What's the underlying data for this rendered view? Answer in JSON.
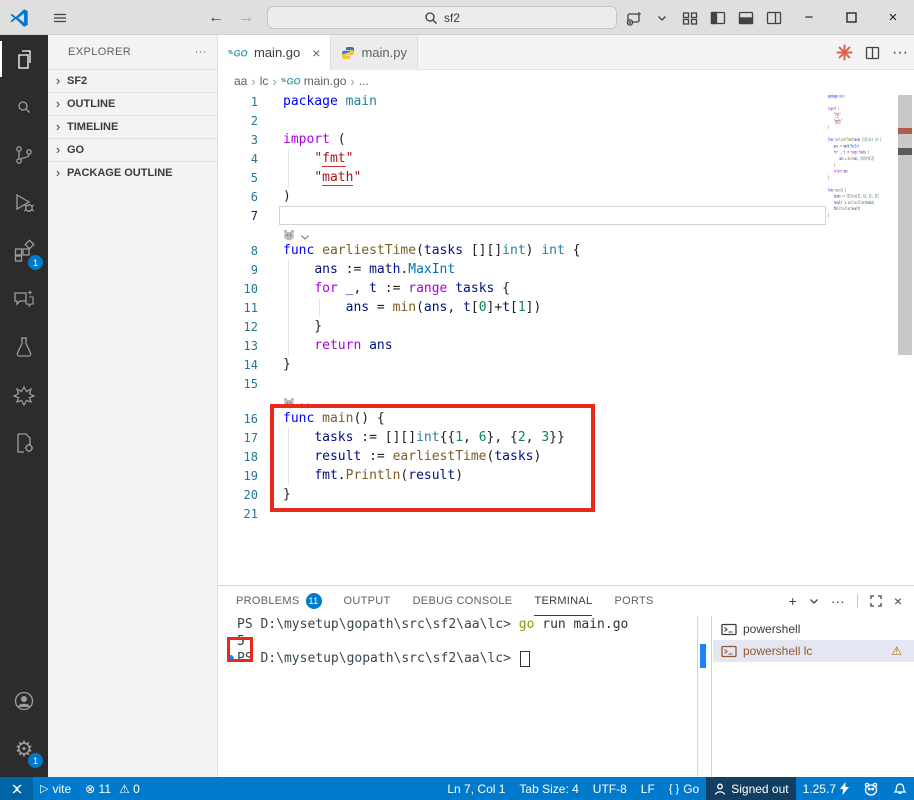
{
  "titlebar": {
    "search_value": "sf2",
    "left_icons": [
      {
        "icon": "vscode-logo-icon"
      },
      {
        "icon": "menu-icon"
      }
    ],
    "nav": [
      {
        "icon": "arrow-left-icon",
        "enabled": true
      },
      {
        "icon": "arrow-right-icon",
        "enabled": false
      }
    ],
    "right_icons": [
      {
        "icon": "profile-launch-icon"
      },
      {
        "icon": "chevron-down-icon"
      },
      {
        "icon": "layout-grid-icon"
      },
      {
        "icon": "panel-left-icon"
      },
      {
        "icon": "panel-bottom-icon"
      },
      {
        "icon": "panel-right-icon"
      }
    ],
    "window_controls": [
      {
        "icon": "minimize-icon",
        "glyph": "−"
      },
      {
        "icon": "maximize-icon"
      },
      {
        "icon": "close-icon",
        "glyph": "×"
      }
    ]
  },
  "activity_bar": {
    "top": [
      {
        "name": "explorer",
        "icon": "files-icon",
        "active": true
      },
      {
        "name": "search",
        "icon": "search-icon"
      },
      {
        "name": "source-control",
        "icon": "source-control-icon"
      },
      {
        "name": "run-debug",
        "icon": "debug-icon"
      },
      {
        "name": "extensions",
        "icon": "extensions-icon",
        "badge": "1"
      },
      {
        "name": "chat",
        "icon": "chat-icon"
      },
      {
        "name": "testing",
        "icon": "beaker-icon"
      },
      {
        "name": "pinwheel",
        "icon": "pinwheel-icon"
      },
      {
        "name": "file-settings",
        "icon": "file-gear-icon"
      }
    ],
    "bottom": [
      {
        "name": "accounts",
        "icon": "account-icon"
      },
      {
        "name": "settings",
        "icon": "gear-icon",
        "badge": "1"
      }
    ]
  },
  "explorer": {
    "title": "EXPLORER",
    "more_icon": "ellipsis-icon",
    "sections": [
      "SF2",
      "OUTLINE",
      "TIMELINE",
      "GO",
      "PACKAGE OUTLINE"
    ]
  },
  "tabs": [
    {
      "label": "main.go",
      "icon": "go-file-icon",
      "active": true,
      "closable": true
    },
    {
      "label": "main.py",
      "icon": "python-file-icon",
      "active": false
    }
  ],
  "editor_actions": [
    {
      "icon": "starburst-icon",
      "color": "#e0614a"
    },
    {
      "icon": "split-editor-icon"
    },
    {
      "icon": "ellipsis-icon"
    }
  ],
  "breadcrumbs": [
    {
      "label": "aa"
    },
    {
      "label": "lc"
    },
    {
      "label": "main.go",
      "icon": "go-file-icon"
    },
    {
      "label": "..."
    }
  ],
  "editor": {
    "cursor_line": 7,
    "rows": [
      {
        "n": 1,
        "tokens": [
          [
            "package",
            "kw"
          ],
          [
            " "
          ],
          [
            "main",
            "type"
          ]
        ]
      },
      {
        "n": 2,
        "tokens": []
      },
      {
        "n": 3,
        "tokens": [
          [
            "import",
            "ctrl"
          ],
          [
            " ("
          ]
        ]
      },
      {
        "n": 4,
        "tokens": [
          [
            "    "
          ],
          [
            "\"",
            "str"
          ],
          [
            "fmt",
            "str strerr"
          ],
          [
            "\"",
            "str"
          ]
        ]
      },
      {
        "n": 5,
        "tokens": [
          [
            "    "
          ],
          [
            "\"",
            "str"
          ],
          [
            "math",
            "str strerr"
          ],
          [
            "\"",
            "str"
          ]
        ]
      },
      {
        "n": 6,
        "tokens": [
          [
            ")"
          ]
        ]
      },
      {
        "n": 7,
        "tokens": []
      },
      {
        "type": "lens"
      },
      {
        "n": 8,
        "tokens": [
          [
            "func",
            "kw"
          ],
          [
            " "
          ],
          [
            "earliestTime",
            "fn"
          ],
          [
            "("
          ],
          [
            "tasks",
            "var"
          ],
          [
            " [][]"
          ],
          [
            "int",
            "type"
          ],
          [
            ") "
          ],
          [
            "int",
            "type"
          ],
          [
            " {"
          ]
        ]
      },
      {
        "n": 9,
        "tokens": [
          [
            "    "
          ],
          [
            "ans",
            "var"
          ],
          [
            " := "
          ],
          [
            "math",
            "var"
          ],
          [
            "."
          ],
          [
            "MaxInt",
            "const"
          ]
        ]
      },
      {
        "n": 10,
        "tokens": [
          [
            "    "
          ],
          [
            "for",
            "ctrl"
          ],
          [
            " "
          ],
          [
            "_",
            "var"
          ],
          [
            ", "
          ],
          [
            "t",
            "var"
          ],
          [
            " := "
          ],
          [
            "range",
            "ctrl"
          ],
          [
            " "
          ],
          [
            "tasks",
            "var"
          ],
          [
            " {"
          ]
        ]
      },
      {
        "n": 11,
        "tokens": [
          [
            "        "
          ],
          [
            "ans",
            "var"
          ],
          [
            " = "
          ],
          [
            "min",
            "fn"
          ],
          [
            "("
          ],
          [
            "ans",
            "var"
          ],
          [
            ", "
          ],
          [
            "t",
            "var"
          ],
          [
            "["
          ],
          [
            "0",
            "num"
          ],
          [
            "]+"
          ],
          [
            "t",
            "var"
          ],
          [
            "["
          ],
          [
            "1",
            "num"
          ],
          [
            "])"
          ]
        ]
      },
      {
        "n": 12,
        "tokens": [
          [
            "    }"
          ]
        ]
      },
      {
        "n": 13,
        "tokens": [
          [
            "    "
          ],
          [
            "return",
            "ctrl"
          ],
          [
            " "
          ],
          [
            "ans",
            "var"
          ]
        ]
      },
      {
        "n": 14,
        "tokens": [
          [
            "}"
          ]
        ]
      },
      {
        "n": 15,
        "tokens": []
      },
      {
        "type": "lens"
      },
      {
        "n": 16,
        "tokens": [
          [
            "func",
            "kw"
          ],
          [
            " "
          ],
          [
            "main",
            "fn"
          ],
          [
            "() {"
          ]
        ]
      },
      {
        "n": 17,
        "tokens": [
          [
            "    "
          ],
          [
            "tasks",
            "var"
          ],
          [
            " := [][]"
          ],
          [
            "int",
            "type"
          ],
          [
            "{{"
          ],
          [
            "1",
            "num"
          ],
          [
            ", "
          ],
          [
            "6",
            "num"
          ],
          [
            "}, {"
          ],
          [
            "2",
            "num"
          ],
          [
            ", "
          ],
          [
            "3",
            "num"
          ],
          [
            "}}"
          ]
        ]
      },
      {
        "n": 18,
        "tokens": [
          [
            "    "
          ],
          [
            "result",
            "var"
          ],
          [
            " := "
          ],
          [
            "earliestTime",
            "fn"
          ],
          [
            "("
          ],
          [
            "tasks",
            "var"
          ],
          [
            ")"
          ]
        ]
      },
      {
        "n": 19,
        "tokens": [
          [
            "    "
          ],
          [
            "fmt",
            "var"
          ],
          [
            "."
          ],
          [
            "Println",
            "fn"
          ],
          [
            "("
          ],
          [
            "result",
            "var"
          ],
          [
            ")"
          ]
        ]
      },
      {
        "n": 20,
        "tokens": [
          [
            "}"
          ]
        ]
      },
      {
        "n": 21,
        "tokens": []
      }
    ]
  },
  "panel": {
    "tabs": [
      {
        "label": "PROBLEMS",
        "badge": "11"
      },
      {
        "label": "OUTPUT"
      },
      {
        "label": "DEBUG CONSOLE"
      },
      {
        "label": "TERMINAL",
        "active": true
      },
      {
        "label": "PORTS"
      }
    ],
    "actions": [
      {
        "icon": "plus-icon",
        "glyph": "+"
      },
      {
        "icon": "chevron-down-icon"
      },
      {
        "icon": "ellipsis-icon",
        "glyph": "···"
      },
      {
        "sep": true
      },
      {
        "icon": "expand-icon"
      },
      {
        "icon": "close-icon",
        "glyph": "×"
      }
    ]
  },
  "terminal": {
    "lines": [
      {
        "tokens": [
          [
            "PS D:\\mysetup\\gopath\\src\\sf2\\aa\\lc> ",
            "prompt"
          ],
          [
            "go",
            "cmd"
          ],
          [
            " run main.go",
            "fg"
          ]
        ]
      },
      {
        "tokens": [
          [
            "5",
            "fg"
          ]
        ]
      },
      {
        "tokens": [
          [
            "PS D:\\mysetup\\gopath\\src\\sf2\\aa\\lc> ",
            "prompt"
          ]
        ],
        "decorated": true,
        "cursor": true
      }
    ],
    "list": [
      {
        "label": "powershell",
        "icon": "terminal-icon"
      },
      {
        "label": "powershell lc",
        "icon": "terminal-icon",
        "selected": true,
        "warning": true
      }
    ]
  },
  "status_bar": {
    "left": [
      {
        "name": "remote",
        "icon": "remote-icon"
      },
      {
        "name": "run-task",
        "icon": "play-icon",
        "label": "vite"
      },
      {
        "name": "problems",
        "parts": [
          [
            "error-icon",
            "11"
          ],
          [
            "warning-icon",
            "0"
          ]
        ]
      }
    ],
    "right": [
      {
        "name": "cursor-position",
        "label": "Ln 7, Col 1"
      },
      {
        "name": "indentation",
        "label": "Tab Size: 4"
      },
      {
        "name": "encoding",
        "label": "UTF-8"
      },
      {
        "name": "eol",
        "label": "LF"
      },
      {
        "name": "language-mode",
        "icon": "braces-icon",
        "label": "Go"
      },
      {
        "name": "signed-out",
        "icon": "person-icon",
        "label": "Signed out",
        "prominent": true
      },
      {
        "name": "go-version",
        "label": "1.25.7",
        "trail_icon": "lightning-icon"
      },
      {
        "name": "go-status",
        "icon": "gopher-icon"
      },
      {
        "name": "notifications",
        "icon": "bell-icon"
      }
    ]
  },
  "colors": {
    "statusbar": "#007acc",
    "badge": "#007acc",
    "annotation_red": "#e8291c",
    "activitybar_bg": "#2c2c2c",
    "titlebar_bg": "#dfdfdf",
    "sidebar_bg": "#f3f3f3",
    "selected_terminal_row": "#e4e6f1",
    "warning_text": "#915930",
    "tokens": {
      "kw": "#0000ff",
      "ctrl": "#af00db",
      "type": "#267f99",
      "fn": "#795e26",
      "var": "#001080",
      "const": "#0070c1",
      "str": "#a31515",
      "num": "#098658",
      "pln": "#1e1e1e"
    },
    "terminal_tokens": {
      "prompt": "#37474f",
      "cmd": "#949800",
      "fg": "#333333"
    }
  }
}
